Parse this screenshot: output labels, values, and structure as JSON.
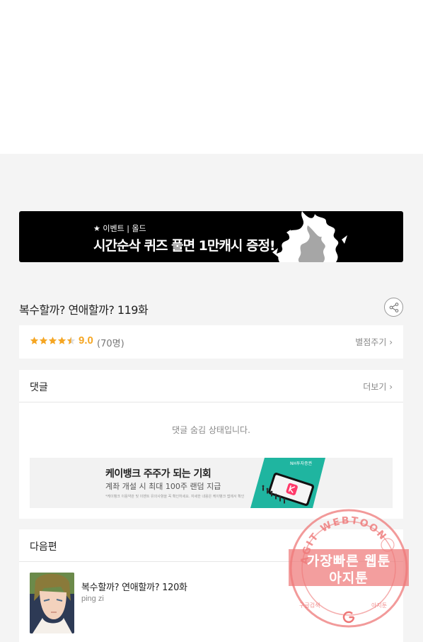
{
  "banner": {
    "tag": "★ 이벤트 | 올드",
    "title": "시간순삭 퀴즈 풀면 1만캐시 증정!"
  },
  "episode": {
    "title": "복수할까? 연애할까? 119화",
    "score": "9.0",
    "count": "(70명)",
    "rating_value": 4.5,
    "rate_link": "별점주기 ›"
  },
  "comments": {
    "title": "댓글",
    "more": "더보기 ›",
    "hidden_message": "댓글 숨김 상태입니다."
  },
  "ad": {
    "title": "케이뱅크 주주가 되는 기회",
    "subtitle": "계좌 개설 시 최대 100주 랜덤 지급",
    "fine_print": "*케이뱅크 이용약관 및 이벤트 유의사항을 꼭 확인하세요. 자세한 내용은 케이뱅크 앱에서 확인",
    "brand": "NH투자증권"
  },
  "next": {
    "title": "다음편",
    "item_title": "복수할까? 연애할까? 120화",
    "item_author": "ping zi"
  },
  "watermark": {
    "arc_text": "AGIT WEBTOON",
    "line1": "가장빠른 웹툰",
    "line2": "아지툰",
    "bottom_left": "구글검색",
    "bottom_right": "아지툰"
  },
  "colors": {
    "star": "#f5a623",
    "banner_bg": "#000000",
    "ad_teal": "#1fb5a0",
    "watermark": "#ee7878"
  }
}
